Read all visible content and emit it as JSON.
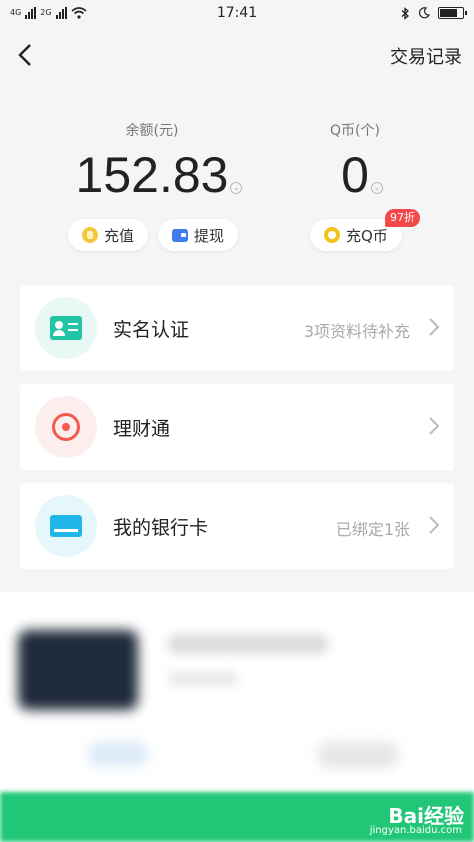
{
  "status_bar": {
    "signal_label_1": "4G",
    "signal_label_2": "2G",
    "time": "17:41",
    "icons": [
      "bluetooth-icon",
      "moon-icon",
      "battery-charging-icon"
    ]
  },
  "nav": {
    "back_icon": "chevron-left-icon",
    "records_label": "交易记录"
  },
  "balance": {
    "yuan_label": "余额(元)",
    "yuan_amount": "152.83",
    "q_label": "Q币(个)",
    "q_amount": "0",
    "recharge_label": "充值",
    "withdraw_label": "提现",
    "recharge_q_label": "充Q币",
    "discount_badge": "97折"
  },
  "cards": [
    {
      "title": "实名认证",
      "sub": "3项资料待补充",
      "icon": "id-card-icon"
    },
    {
      "title": "理财通",
      "sub": "",
      "icon": "licaitong-icon"
    },
    {
      "title": "我的银行卡",
      "sub": "已绑定1张",
      "icon": "bank-card-icon"
    }
  ],
  "watermark": {
    "text": "Bai经验",
    "url": "jingyan.baidu.com"
  },
  "colors": {
    "accent_green": "#21c776",
    "badge_red": "#f5484a",
    "id_teal": "#22c4a6",
    "bank_blue": "#1fb7e8",
    "licaitong_red": "#f45a4d"
  }
}
